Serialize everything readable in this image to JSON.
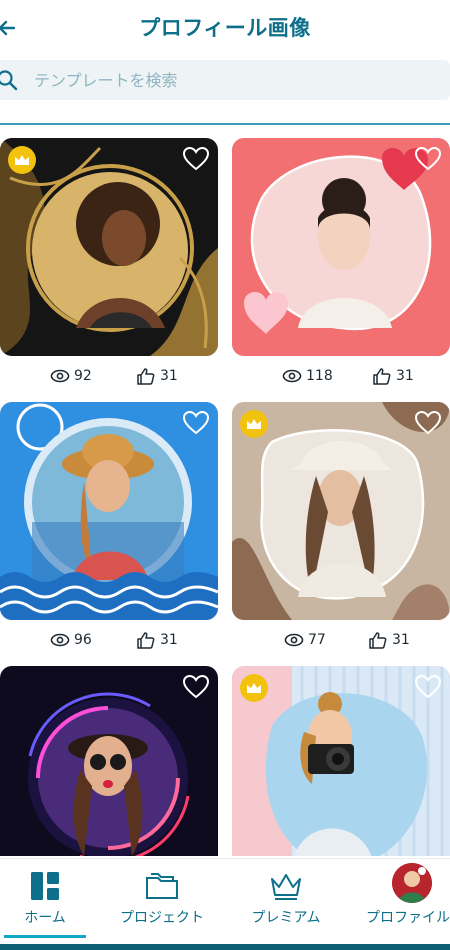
{
  "header": {
    "title": "プロフィール画像"
  },
  "search": {
    "placeholder": "テンプレートを検索"
  },
  "cards": [
    {
      "views": "92",
      "likes": "31",
      "premium": true,
      "favorited": false
    },
    {
      "views": "118",
      "likes": "31",
      "premium": false,
      "favorited": false
    },
    {
      "views": "96",
      "likes": "31",
      "premium": false,
      "favorited": false
    },
    {
      "views": "77",
      "likes": "31",
      "premium": true,
      "favorited": false
    },
    {
      "views": "",
      "likes": "",
      "premium": false,
      "favorited": false
    },
    {
      "views": "",
      "likes": "",
      "premium": true,
      "favorited": false
    }
  ],
  "nav": {
    "home": "ホーム",
    "projects": "プロジェクト",
    "premium": "プレミアム",
    "profile": "プロファイル"
  },
  "colors": {
    "accent": "#0d6f8a",
    "crown": "#f2c20f",
    "underline": "#12a7c9"
  }
}
